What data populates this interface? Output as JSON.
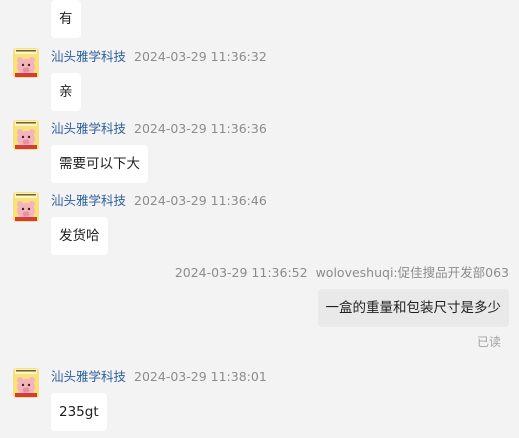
{
  "messages": [
    {
      "type": "incoming",
      "text": "有"
    },
    {
      "type": "incoming",
      "sender": "汕头雅学科技",
      "time": "2024-03-29 11:36:32",
      "text": "亲"
    },
    {
      "type": "incoming",
      "sender": "汕头雅学科技",
      "time": "2024-03-29 11:36:36",
      "text": "需要可以下大"
    },
    {
      "type": "incoming",
      "sender": "汕头雅学科技",
      "time": "2024-03-29 11:36:46",
      "text": "发货哈"
    },
    {
      "type": "outgoing",
      "time": "2024-03-29 11:36:52",
      "sender": "woloveshuqi:促佳搜品开发部063",
      "text": "一盒的重量和包装尺寸是多少",
      "status": "已读"
    },
    {
      "type": "incoming",
      "sender": "汕头雅学科技",
      "time": "2024-03-29 11:38:01",
      "text": "235gt"
    }
  ],
  "colors": {
    "background": "#f3f3f3",
    "sender_name": "#2e5e9e",
    "timestamp": "#8c8c8c",
    "bubble_incoming": "#ffffff",
    "bubble_outgoing": "#e9e9e9"
  },
  "icons": {
    "avatar": "pig-avatar-icon"
  }
}
